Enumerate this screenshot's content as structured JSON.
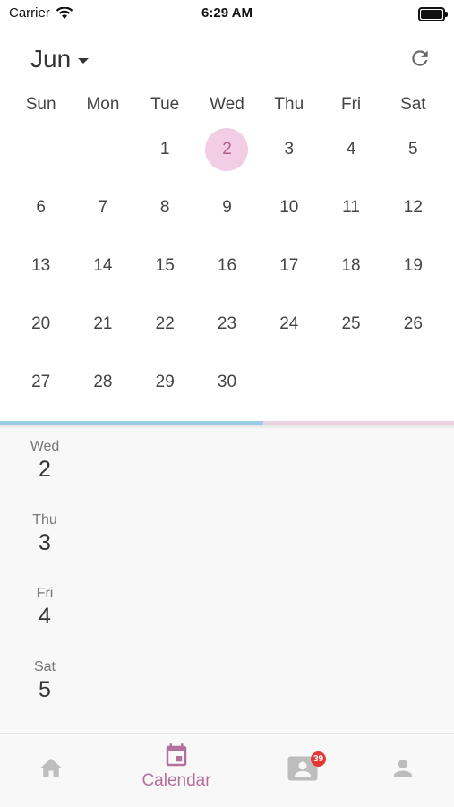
{
  "status_bar": {
    "carrier": "Carrier",
    "time": "6:29 AM"
  },
  "header": {
    "month": "Jun"
  },
  "weekdays": [
    "Sun",
    "Mon",
    "Tue",
    "Wed",
    "Thu",
    "Fri",
    "Sat"
  ],
  "weeks": [
    [
      "",
      "",
      "1",
      "2",
      "3",
      "4",
      "5"
    ],
    [
      "6",
      "7",
      "8",
      "9",
      "10",
      "11",
      "12"
    ],
    [
      "13",
      "14",
      "15",
      "16",
      "17",
      "18",
      "19"
    ],
    [
      "20",
      "21",
      "22",
      "23",
      "24",
      "25",
      "26"
    ],
    [
      "27",
      "28",
      "29",
      "30",
      "",
      "",
      ""
    ]
  ],
  "selected_day": "2",
  "agenda": [
    {
      "dow": "Wed",
      "day": "2"
    },
    {
      "dow": "Thu",
      "day": "3"
    },
    {
      "dow": "Fri",
      "day": "4"
    },
    {
      "dow": "Sat",
      "day": "5"
    }
  ],
  "bottom_nav": {
    "calendar_label": "Calendar",
    "messages_badge": "39",
    "active_color": "#b3709b",
    "inactive_color": "#bdbdbd"
  },
  "colors": {
    "selected_day_bg": "#f2cde3",
    "selected_day_text": "#b35f8f",
    "divider_blue": "#9ccbe8",
    "divider_pink": "#ecd3e2"
  }
}
